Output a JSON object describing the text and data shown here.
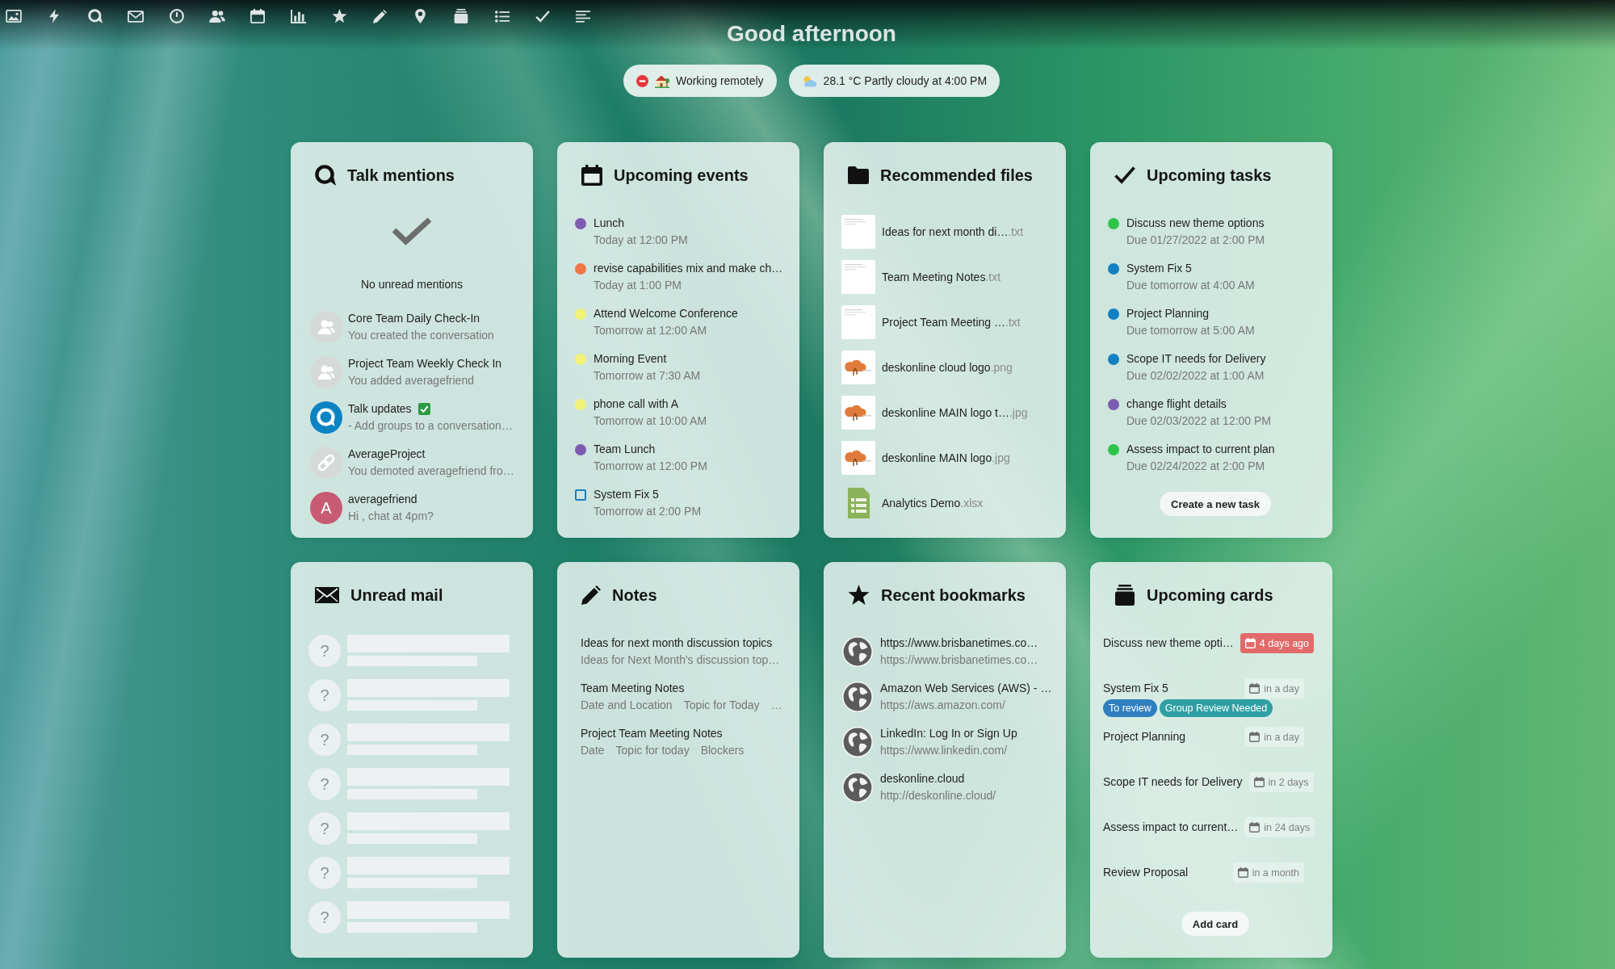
{
  "greeting": "Good afternoon",
  "status_pills": [
    {
      "kind": "status",
      "text": "Working remotely"
    },
    {
      "kind": "weather",
      "text": "28.1 °C Partly cloudy at 4:00 PM"
    }
  ],
  "widgets": [
    {
      "kind": "talk",
      "title": "Talk mentions",
      "empty_message": "No unread mentions",
      "items": [
        {
          "kind": "group",
          "title": "Core Team Daily Check-In",
          "check_emoji": false,
          "subtitle": "You created the conversation"
        },
        {
          "kind": "group",
          "title": "Project Team Weekly Check In",
          "check_emoji": false,
          "subtitle": "You added averagefriend"
        },
        {
          "kind": "talk",
          "title": "Talk updates",
          "check_emoji": true,
          "subtitle": "- Add groups to a conversation…"
        },
        {
          "kind": "link",
          "title": "AverageProject",
          "check_emoji": false,
          "subtitle": "You demoted averagefriend fro…"
        },
        {
          "kind": "initial",
          "initial": "A",
          "color": "#c95a73",
          "title": "averagefriend",
          "check_emoji": false,
          "subtitle": "Hi , chat at 4pm?"
        }
      ]
    },
    {
      "kind": "calendar",
      "title": "Upcoming events",
      "items": [
        {
          "kind": "event",
          "color": "#7d5cb0",
          "title": "Lunch",
          "time": "Today at 12:00 PM"
        },
        {
          "kind": "event",
          "color": "#ee7748",
          "title": "revise capabilities mix and make ch…",
          "time": "Today at 1:00 PM"
        },
        {
          "kind": "event",
          "color": "#f2f27a",
          "title": "Attend Welcome Conference",
          "time": "Tomorrow at 12:00 AM"
        },
        {
          "kind": "event",
          "color": "#f2f27a",
          "title": "Morning Event",
          "time": "Tomorrow at 7:30 AM"
        },
        {
          "kind": "event",
          "color": "#f2f27a",
          "title": "phone call with A",
          "time": "Tomorrow at 10:00 AM"
        },
        {
          "kind": "event",
          "color": "#7d5cb0",
          "title": "Team Lunch",
          "time": "Tomorrow at 12:00 PM"
        },
        {
          "kind": "task",
          "checked": false,
          "title": "System Fix 5",
          "time": "Tomorrow at 2:00 PM"
        }
      ]
    },
    {
      "kind": "files",
      "title": "Recommended files",
      "items": [
        {
          "kind": "document",
          "name": "Ideas for next month di…",
          "extension": ".txt"
        },
        {
          "kind": "document",
          "name": "Team Meeting Notes",
          "extension": ".txt"
        },
        {
          "kind": "document",
          "name": "Project Team Meeting …",
          "extension": ".txt"
        },
        {
          "kind": "image",
          "name": "deskonline cloud logo",
          "extension": ".png"
        },
        {
          "kind": "image",
          "name": "deskonline MAIN logo t…",
          "extension": ".jpg"
        },
        {
          "kind": "image",
          "name": "deskonline MAIN logo",
          "extension": ".jpg"
        },
        {
          "kind": "spreadsheet",
          "name": "Analytics Demo",
          "extension": ".xlsx"
        }
      ]
    },
    {
      "kind": "tasks",
      "title": "Upcoming tasks",
      "items": [
        {
          "color": "#2ec44a",
          "title": "Discuss new theme options",
          "due": "Due 01/27/2022 at 2:00 PM"
        },
        {
          "color": "#1380c2",
          "title": "System Fix 5",
          "due": "Due tomorrow at 4:00 AM"
        },
        {
          "color": "#1380c2",
          "title": "Project Planning",
          "due": "Due tomorrow at 5:00 AM"
        },
        {
          "color": "#1380c2",
          "title": "Scope IT needs for Delivery",
          "due": "Due 02/02/2022 at 1:00 AM"
        },
        {
          "color": "#7d5cb0",
          "title": "change flight details",
          "due": "Due 02/03/2022 at 12:00 PM"
        },
        {
          "color": "#2ec44a",
          "title": "Assess impact to current plan",
          "due": "Due 02/24/2022 at 2:00 PM"
        }
      ],
      "button": "Create a new task"
    },
    {
      "kind": "mail",
      "title": "Unread mail",
      "placeholder_rows": [
        {
          "avatar": "?"
        },
        {
          "avatar": "?"
        },
        {
          "avatar": "?"
        },
        {
          "avatar": "?"
        },
        {
          "avatar": "?"
        },
        {
          "avatar": "?"
        },
        {
          "avatar": "?"
        }
      ]
    },
    {
      "kind": "notes",
      "title": "Notes",
      "items": [
        {
          "title": "Ideas for next month discussion topics",
          "excerpt": [
            "Ideas for Next Month's discussion top…"
          ]
        },
        {
          "title": "Team Meeting Notes",
          "excerpt": [
            "Date and Location",
            "Topic for Today",
            "…"
          ]
        },
        {
          "title": "Project Team Meeting Notes",
          "excerpt": [
            "Date",
            "Topic for today",
            "Blockers"
          ]
        }
      ]
    },
    {
      "kind": "bookmarks",
      "title": "Recent bookmarks",
      "items": [
        {
          "title": "https://www.brisbanetimes.co…",
          "url": "https://www.brisbanetimes.co…"
        },
        {
          "title": "Amazon Web Services (AWS) - …",
          "url": "https://aws.amazon.com/"
        },
        {
          "title": "LinkedIn: Log In or Sign Up",
          "url": "https://www.linkedin.com/"
        },
        {
          "title": "deskonline.cloud",
          "url": "http://deskonline.cloud/"
        }
      ]
    },
    {
      "kind": "deck",
      "title": "Upcoming cards",
      "items": [
        {
          "title": "Discuss new theme opti…",
          "due": "4 days ago",
          "overdue": true
        },
        {
          "title": "System Fix 5",
          "due": "in a day",
          "overdue": false,
          "labels": [
            {
              "text": "To review",
              "color": "#2f7fbf"
            },
            {
              "text": "Group Review Needed",
              "color": "#2e9fa3"
            }
          ]
        },
        {
          "title": "Project Planning",
          "due": "in a day",
          "overdue": false
        },
        {
          "title": "Scope IT needs for Delivery",
          "due": "in 2 days",
          "overdue": false
        },
        {
          "title": "Assess impact to current…",
          "due": "in 24 days",
          "overdue": false
        },
        {
          "title": "Review Proposal",
          "due": "in a month",
          "overdue": false
        }
      ],
      "button": "Add card"
    }
  ]
}
